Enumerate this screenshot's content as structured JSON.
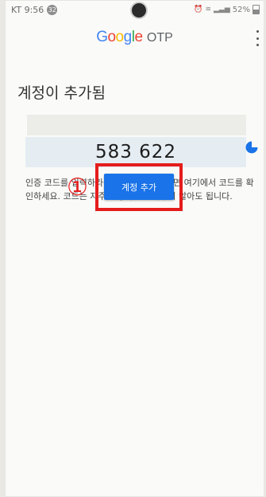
{
  "status_bar": {
    "carrier_time": "KT 9:56",
    "notification_badge": "32",
    "battery_percent": "52%"
  },
  "app_bar": {
    "brand": "Google",
    "product": "OTP",
    "brand_letter_colors": [
      "#4285F4",
      "#EA4335",
      "#FBBC05",
      "#4285F4",
      "#34A853",
      "#EA4335"
    ]
  },
  "page": {
    "heading": "계정이 추가됨",
    "otp_code": "583 622",
    "description": "인증 코드를 입력하라는 메시지가 표시되면 여기에서 코드를 확인하세요. 코드는 자주 변경되므로 외우지 않아도 됩니다.",
    "add_account_button": "계정 추가"
  },
  "annotation": {
    "step_marker": "①",
    "color": "#e51c1c"
  },
  "timer": {
    "remaining_fraction": 0.75,
    "color": "#1a73e8"
  }
}
